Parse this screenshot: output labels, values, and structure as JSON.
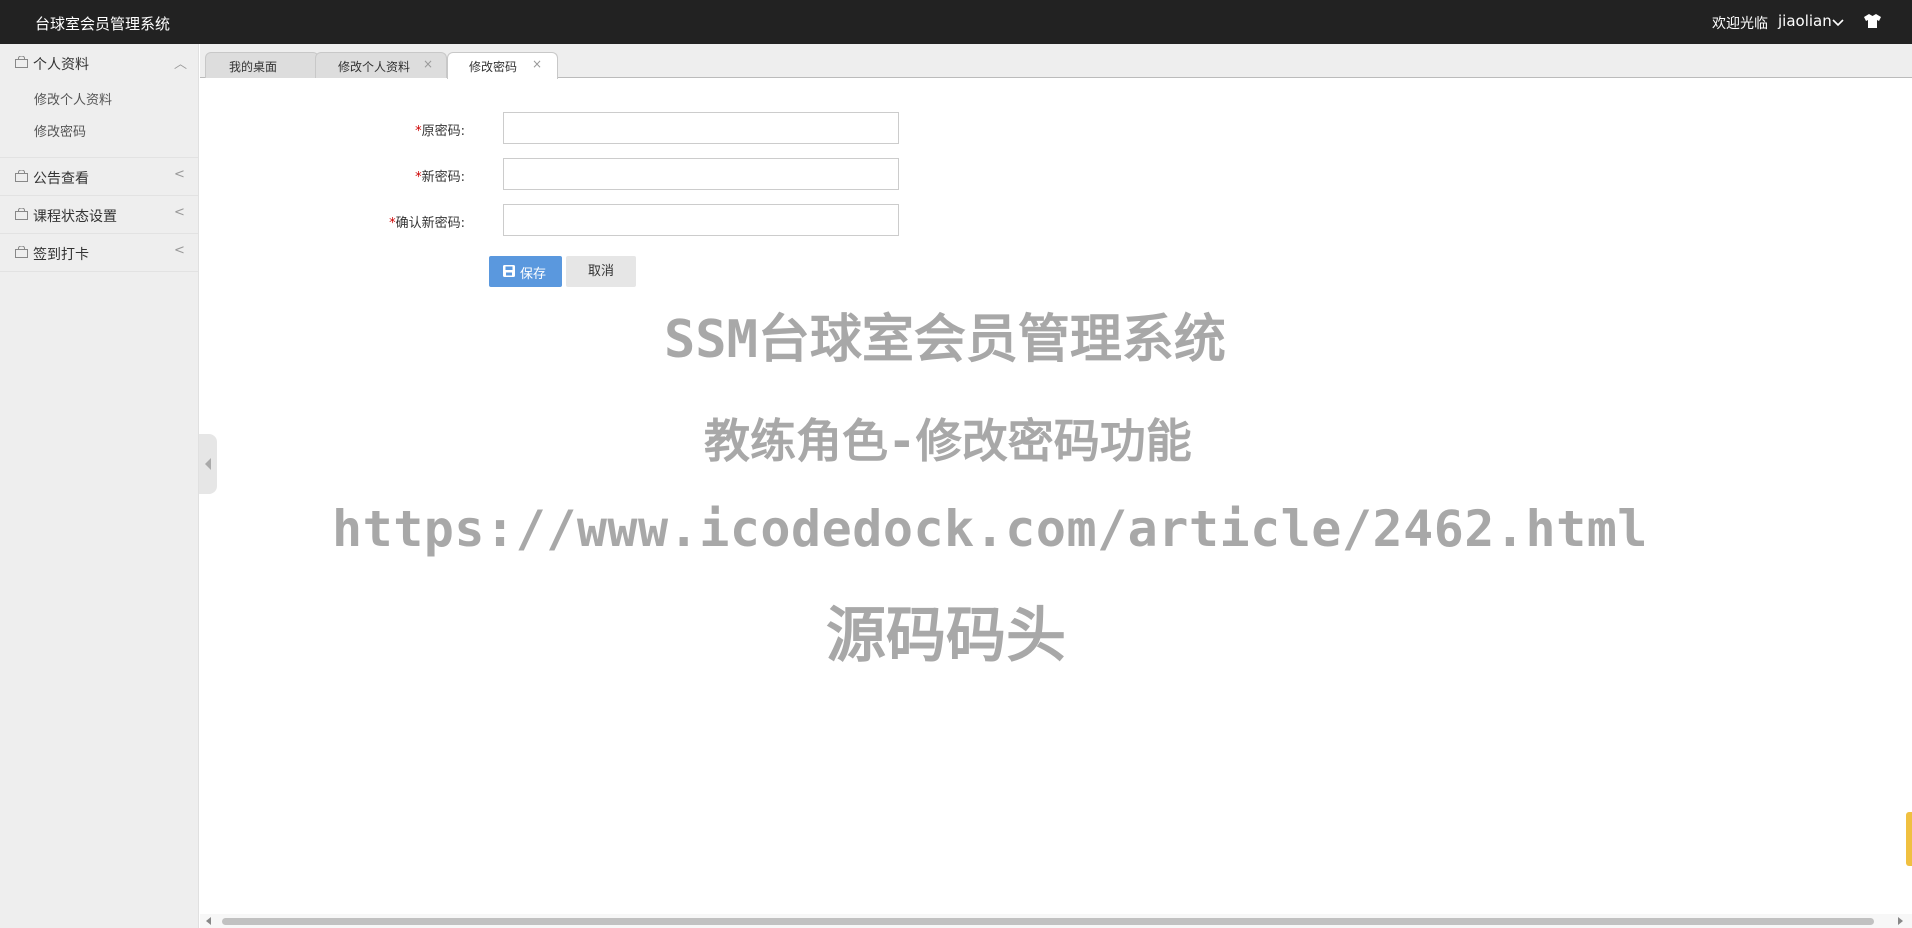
{
  "header": {
    "app_title": "台球室会员管理系统",
    "welcome": "欢迎光临",
    "username": "jiaolian"
  },
  "sidebar": {
    "groups": [
      {
        "label": "个人资料",
        "expanded": true,
        "items": [
          {
            "label": "修改个人资料"
          },
          {
            "label": "修改密码"
          }
        ]
      },
      {
        "label": "公告查看",
        "expanded": false
      },
      {
        "label": "课程状态设置",
        "expanded": false
      },
      {
        "label": "签到打卡",
        "expanded": false
      }
    ]
  },
  "tabs": [
    {
      "label": "我的桌面",
      "closable": false,
      "active": false
    },
    {
      "label": "修改个人资料",
      "closable": true,
      "active": false
    },
    {
      "label": "修改密码",
      "closable": true,
      "active": true
    }
  ],
  "form": {
    "required_mark": "*",
    "fields": [
      {
        "label": "原密码:",
        "value": ""
      },
      {
        "label": "新密码:",
        "value": ""
      },
      {
        "label": "确认新密码:",
        "value": ""
      }
    ],
    "save_label": "保存",
    "cancel_label": "取消"
  },
  "watermark": {
    "line1": "SSM台球室会员管理系统",
    "line2": "教练角色-修改密码功能",
    "line3": "https://www.icodedock.com/article/2462.html",
    "line4": "源码码头"
  },
  "icons": {
    "close": "×",
    "arrow_expanded": "︿",
    "arrow_collapsed": "<"
  },
  "colors": {
    "topbar_bg": "#222222",
    "primary_button": "#5a98de",
    "required_mark": "#cc0000",
    "sidebar_bg": "#eeeeee"
  }
}
